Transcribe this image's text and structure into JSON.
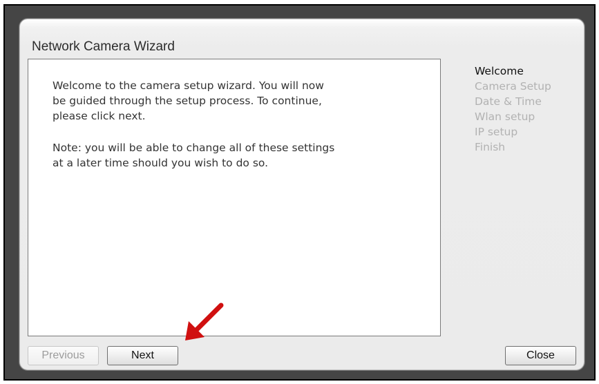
{
  "wizard": {
    "title": "Network Camera Wizard",
    "message_paragraph_1": "Welcome to the camera setup wizard. You will now be guided through the setup process. To continue, please click next.",
    "message_paragraph_2": "Note: you will be able to change all of these settings at a later time should you wish to do so."
  },
  "steps": [
    {
      "label": "Welcome",
      "active": true
    },
    {
      "label": "Camera Setup",
      "active": false
    },
    {
      "label": "Date & Time",
      "active": false
    },
    {
      "label": "Wlan setup",
      "active": false
    },
    {
      "label": "IP setup",
      "active": false
    },
    {
      "label": "Finish",
      "active": false
    }
  ],
  "buttons": {
    "previous": {
      "label": "Previous",
      "enabled": false
    },
    "next": {
      "label": "Next",
      "enabled": true
    },
    "close": {
      "label": "Close",
      "enabled": true
    }
  },
  "colors": {
    "annotation_arrow": "#d01010",
    "frame_background": "#454545",
    "active_step": "#111111",
    "inactive_step": "#b2b2b2"
  }
}
